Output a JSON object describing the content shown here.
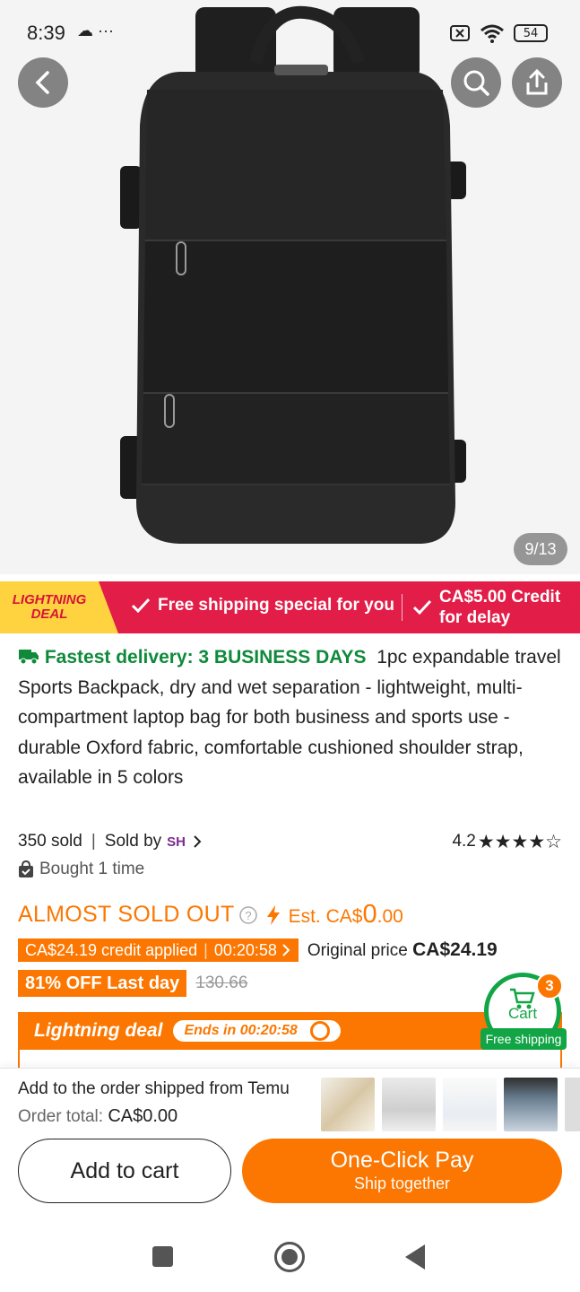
{
  "status_bar": {
    "time": "8:39",
    "left_icons": "☁ ···",
    "battery": "54"
  },
  "gallery": {
    "counter": "9/13",
    "image_alt": "Black travel backpack"
  },
  "promo_bar": {
    "badge_line1": "LIGHTNING",
    "badge_line2": "DEAL",
    "free_shipping": "Free shipping special for you",
    "credit_line1": "CA$5.00 Credit",
    "credit_line2": "for delay"
  },
  "product": {
    "fastest_delivery": "Fastest delivery: 3 BUSINESS DAYS",
    "title": "1pc expandable travel Sports Backpack, dry and wet separation - lightweight, multi-compartment laptop bag for both business and sports use - durable Oxford fabric, comfortable cushioned shoulder strap, available in 5 colors",
    "sold": "350 sold",
    "sold_by": "Sold by",
    "seller_logo": "SH",
    "rating": "4.2",
    "stars": "★★★★☆",
    "bought": "Bought 1 time"
  },
  "pricing": {
    "almost_sold_out": "ALMOST SOLD OUT",
    "est_prefix": "Est. CA$",
    "est_big": "0",
    "est_cents": ".00",
    "credit_applied": "CA$24.19 credit applied",
    "credit_timer": "00:20:58",
    "original_label": "Original price",
    "original_price": "CA$24.19",
    "discount": "81% OFF Last day",
    "strike_price": "130.66"
  },
  "lightning_deal": {
    "title": "Lightning deal",
    "ends": "Ends in 00:20:58"
  },
  "cart_float": {
    "label": "Cart",
    "count": "3",
    "free_shipping": "Free shipping"
  },
  "bottom_bar": {
    "ship_text": "Add to the order shipped from Temu",
    "order_total_label": "Order total:",
    "order_total_value": "CA$0.00",
    "add_to_cart": "Add to cart",
    "pay_line1": "One-Click Pay",
    "pay_line2": "Ship together"
  },
  "colors": {
    "accent": "#fb7701",
    "promo_red": "#e11d48",
    "green": "#0f8a3b"
  }
}
